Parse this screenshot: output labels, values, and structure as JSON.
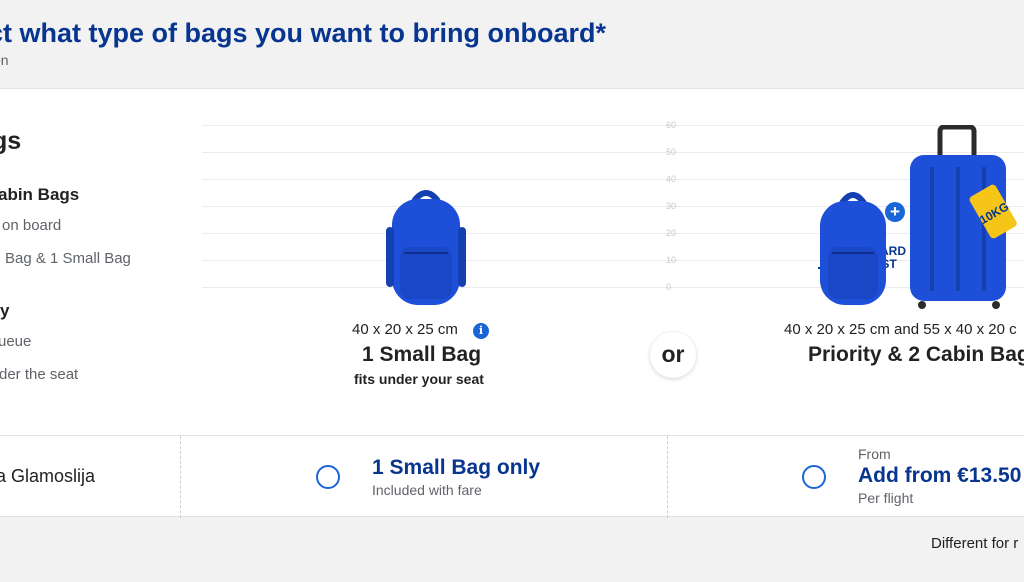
{
  "header": {
    "title": "ct what type of bags you want to bring onboard*",
    "subtitle": "on"
  },
  "comparison": {
    "heading": "gs",
    "feature_group_1": {
      "title": "abin Bags",
      "lines": [
        "on board",
        "Bag & 1 Small Bag"
      ]
    },
    "feature_group_2": {
      "title": "y",
      "lines": [
        "ueue",
        "der the seat"
      ]
    },
    "scale_ticks": [
      "60",
      "50",
      "40",
      "30",
      "20",
      "10",
      "0"
    ]
  },
  "option_small": {
    "dimensions": "40 x 20 x 25 cm",
    "info_icon": "info-icon",
    "title": "1 Small Bag",
    "note": "fits under your seat",
    "colors": {
      "bag": "#1e4fd8"
    }
  },
  "or_label": "or",
  "option_priority": {
    "badge_line1": "BOARD",
    "badge_line2": "FIRST",
    "tag_text": "10KG",
    "dimensions": "40 x 20 x 25 cm and 55 x 40 x 20 c",
    "title": "Priority & 2 Cabin Bag",
    "colors": {
      "bag": "#1e4fd8",
      "tag": "#f5c518"
    }
  },
  "selector": {
    "passenger": "a Glamoslija",
    "small_option": {
      "label": "1 Small Bag only",
      "sub": "Included with fare"
    },
    "priority_option": {
      "from": "From",
      "label": "Add from €13.50",
      "sub": "Per flight"
    }
  },
  "footer": {
    "note": "Different for r"
  },
  "colors": {
    "brand_blue": "#073590",
    "accent_blue": "#1b66d6",
    "background": "#f2f2f2"
  }
}
